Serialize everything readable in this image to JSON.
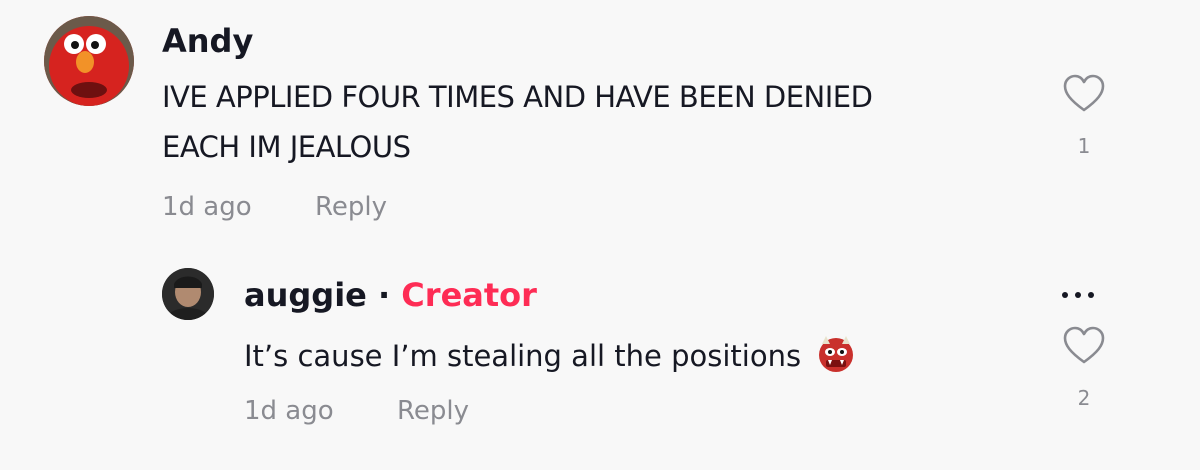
{
  "comments": [
    {
      "username": "Andy",
      "text_line1": "IVE APPLIED FOUR TIMES AND HAVE BEEN DENIED",
      "text_line2": "EACH IM JEALOUS",
      "time": "1d ago",
      "reply_label": "Reply",
      "like_count": "1",
      "avatar_icon": "elmo-avatar"
    }
  ],
  "replies": [
    {
      "username": "auggie",
      "separator": "·",
      "badge": "Creator",
      "text": "It’s cause I’m stealing all the positions",
      "emoji_icon": "ogre-emoji-icon",
      "time": "1d ago",
      "reply_label": "Reply",
      "like_count": "2",
      "avatar_icon": "user-avatar"
    }
  ],
  "colors": {
    "background": "#f8f8f8",
    "text": "#161823",
    "muted": "#8a8b91",
    "creator": "#fe2c55"
  }
}
